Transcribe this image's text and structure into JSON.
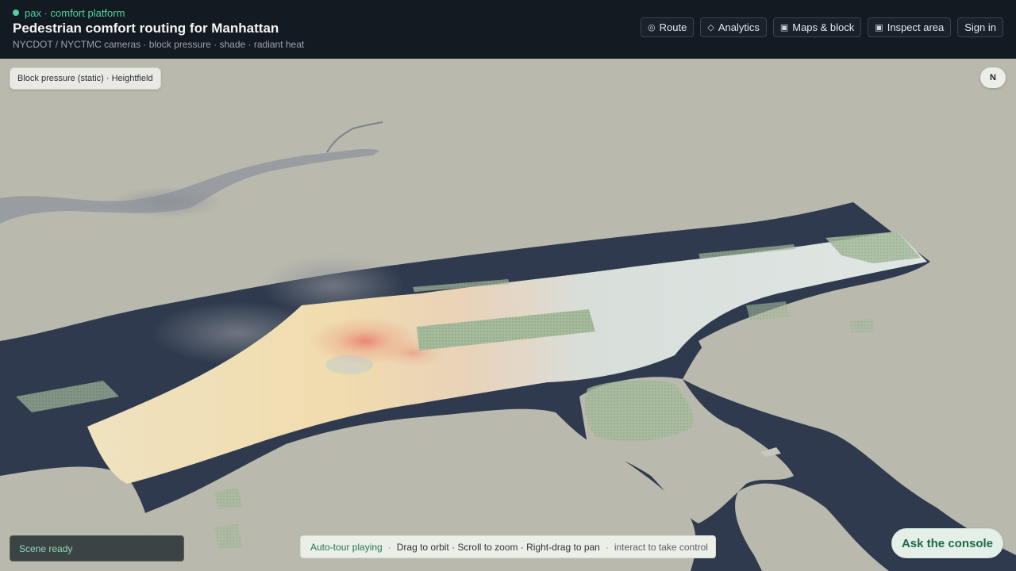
{
  "header": {
    "brand": "pax · comfort platform",
    "title": "Pedestrian comfort routing for Manhattan",
    "subtitle": "NYCDOT / NYCTMC cameras · block pressure · shade · radiant heat"
  },
  "nav": {
    "route": "Route",
    "analytics": "Analytics",
    "maps_block": "Maps & block",
    "inspect_area": "Inspect area",
    "sign_in": "Sign in"
  },
  "map": {
    "layer_label": "Block pressure (static) · Heightfield",
    "compass": "N"
  },
  "status": {
    "scene": "Scene ready"
  },
  "hint": {
    "tour": "Auto-tour playing",
    "controls": "Drag to orbit · Scroll to zoom · Right-drag to pan",
    "take_control": "interact to take control"
  },
  "console": {
    "label": "Ask the console"
  },
  "colors": {
    "accent": "#4fd1a1",
    "water": "#2f3a4e",
    "land": "#b9b9ad",
    "park": "#9fb797"
  }
}
